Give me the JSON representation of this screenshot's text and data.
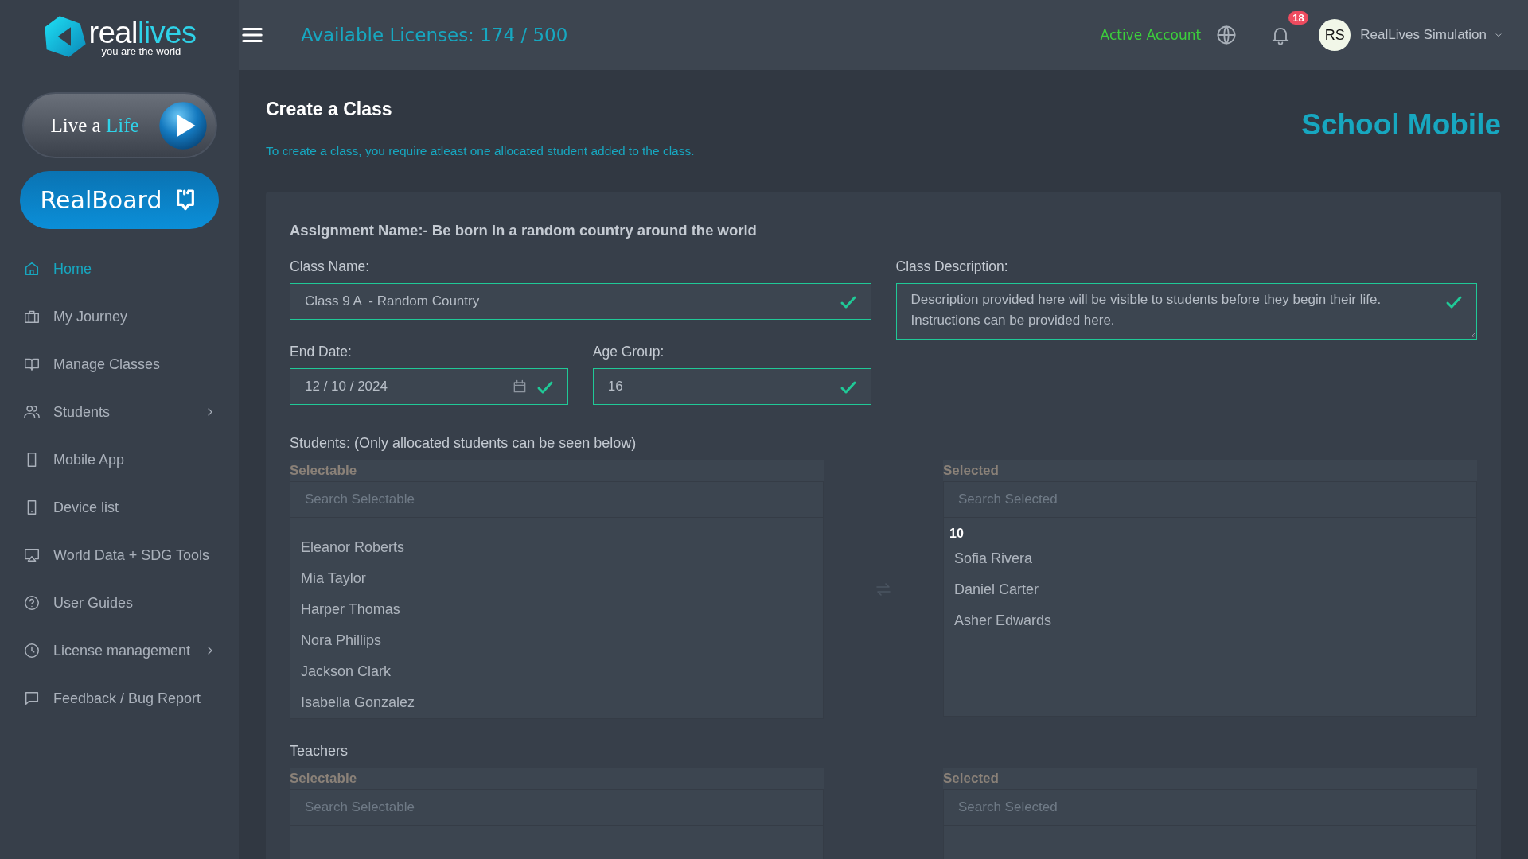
{
  "logo": {
    "wordmark_start": "real",
    "wordmark_end": "lives",
    "tagline": "you are the world"
  },
  "sidebar": {
    "live_button": {
      "label": "Live a",
      "accent": "Life"
    },
    "board_button": {
      "label": "RealBoard"
    },
    "items": [
      {
        "label": "Home",
        "selected": true,
        "expandable": false
      },
      {
        "label": "My Journey",
        "selected": false,
        "expandable": false
      },
      {
        "label": "Manage Classes",
        "selected": false,
        "expandable": false
      },
      {
        "label": "Students",
        "selected": false,
        "expandable": true
      },
      {
        "label": "Mobile App",
        "selected": false,
        "expandable": false
      },
      {
        "label": "Device list",
        "selected": false,
        "expandable": false
      },
      {
        "label": "World Data + SDG Tools",
        "selected": false,
        "expandable": false
      },
      {
        "label": "User Guides",
        "selected": false,
        "expandable": false
      },
      {
        "label": "License management",
        "selected": false,
        "expandable": true
      },
      {
        "label": "Feedback / Bug Report",
        "selected": false,
        "expandable": false
      }
    ]
  },
  "header": {
    "licenses": "Available Licenses: 174 / 500",
    "account_status": "Active Account",
    "notification_count": "18",
    "user": {
      "initials": "RS",
      "name": "RealLives Simulation"
    }
  },
  "page": {
    "title": "Create a Class",
    "hint": "To create a class, you require atleast one allocated student added to the class.",
    "product": "School Mobile"
  },
  "form": {
    "assignment": "Assignment Name:- Be born in a random country around the world",
    "fields": [
      {
        "kind": "text",
        "label": "Class Name:",
        "value": "Class 9 A  - Random Country",
        "valid": true
      },
      {
        "kind": "textarea",
        "label": "Class Description:",
        "value": "Description provided here will be visible to students before they begin their life. Instructions can be provided here.",
        "valid": true
      },
      {
        "kind": "date",
        "label": "End Date:",
        "value": "12 / 10 / 2024",
        "valid": true
      },
      {
        "kind": "text",
        "label": "Age Group:",
        "value": "16",
        "valid": true
      }
    ],
    "pickers": [
      {
        "label": "Students: (Only allocated students can be seen below)",
        "selectable": {
          "header": "Selectable",
          "placeholder": "Search Selectable",
          "items": [
            "Eleanor Roberts",
            "Mia Taylor",
            "Harper Thomas",
            "Nora Phillips",
            "Jackson Clark",
            "Isabella Gonzalez"
          ]
        },
        "selected": {
          "header": "Selected",
          "placeholder": "Search Selected",
          "group": "10",
          "items": [
            "Sofia Rivera",
            "Daniel Carter",
            "Asher Edwards"
          ]
        }
      },
      {
        "label": "Teachers",
        "selectable": {
          "header": "Selectable",
          "placeholder": "Search Selectable"
        },
        "selected": {
          "header": "Selected",
          "placeholder": "Search Selected"
        }
      }
    ]
  }
}
